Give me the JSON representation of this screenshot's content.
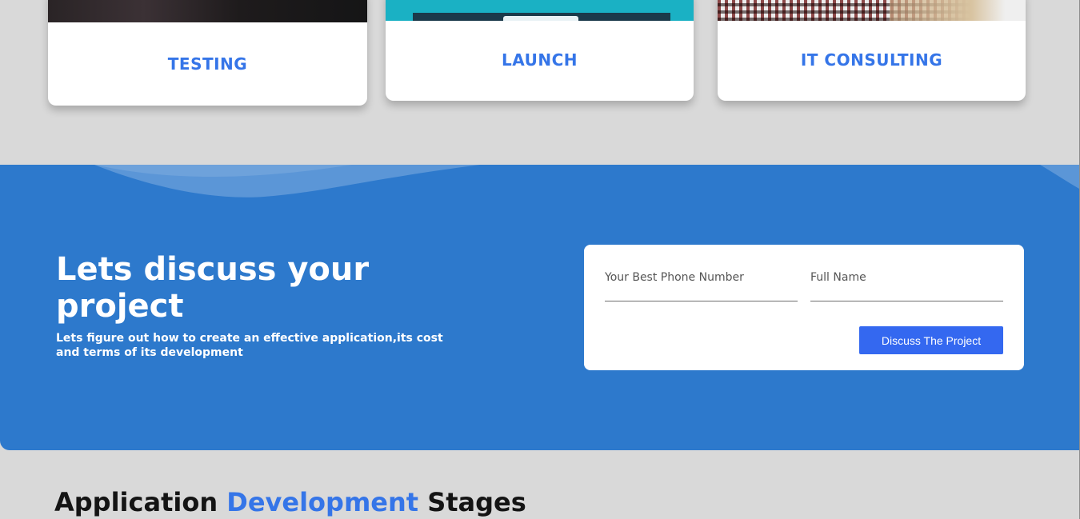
{
  "services": [
    {
      "title": "TESTING"
    },
    {
      "title": "LAUNCH"
    },
    {
      "title": "IT CONSULTING"
    }
  ],
  "cta": {
    "heading": "Lets discuss your project",
    "subtext": "Lets figure out how to create an effective application,its cost and terms of its development",
    "form": {
      "phone_placeholder": "Your Best Phone Number",
      "name_placeholder": "Full Name",
      "submit_label": "Discuss The Project"
    }
  },
  "stages": {
    "heading_part1": "Application",
    "heading_accent": "Development",
    "heading_part2": "Stages"
  },
  "colors": {
    "accent": "#3575e8",
    "band": "#2d79cc",
    "button": "#3468f0",
    "background": "#d9d9d9"
  }
}
